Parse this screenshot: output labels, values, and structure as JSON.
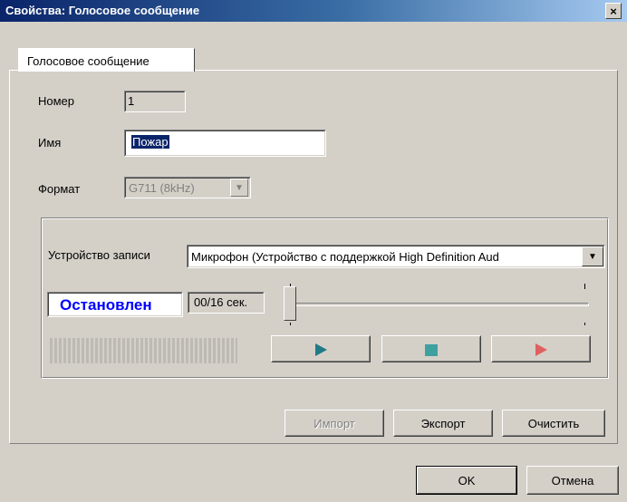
{
  "window": {
    "title": "Свойства: Голосовое сообщение",
    "close_label": "×"
  },
  "tabs": [
    {
      "label": "Голосовое сообщение",
      "selected": true
    }
  ],
  "form": {
    "number_label": "Номер",
    "number_value": "1",
    "name_label": "Имя",
    "name_value": "Пожар",
    "format_label": "Формат",
    "format_value": "G711 (8kHz)"
  },
  "recording": {
    "device_label": "Устройство записи",
    "device_value": "Микрофон (Устройство с поддержкой High Definition Aud",
    "status": "Остановлен",
    "status_color": "#0000ff",
    "time": "00/16 сек.",
    "slider_position": 0,
    "icons": {
      "play": "play-icon",
      "stop": "stop-icon",
      "record": "record-icon"
    }
  },
  "actions": {
    "import_label": "Импорт",
    "export_label": "Экспорт",
    "clear_label": "Очистить"
  },
  "footer": {
    "ok_label": "OK",
    "cancel_label": "Отмена"
  }
}
